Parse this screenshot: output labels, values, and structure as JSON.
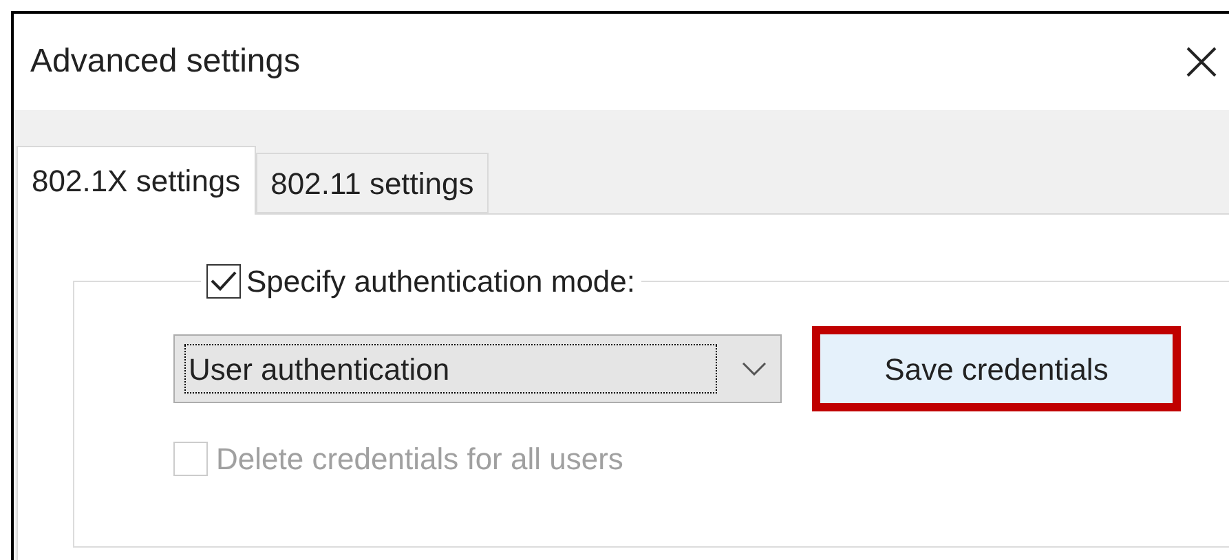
{
  "window": {
    "title": "Advanced settings"
  },
  "tabs": [
    {
      "label": "802.1X settings",
      "selected": true
    },
    {
      "label": "802.11 settings",
      "selected": false
    }
  ],
  "auth_mode": {
    "label": "Specify authentication mode:",
    "checked": true
  },
  "mode_dropdown": {
    "value": "User authentication"
  },
  "save_button": {
    "label": "Save credentials",
    "highlighted": true
  },
  "delete_credentials": {
    "label": "Delete credentials for all users",
    "checked": false,
    "disabled": true
  }
}
